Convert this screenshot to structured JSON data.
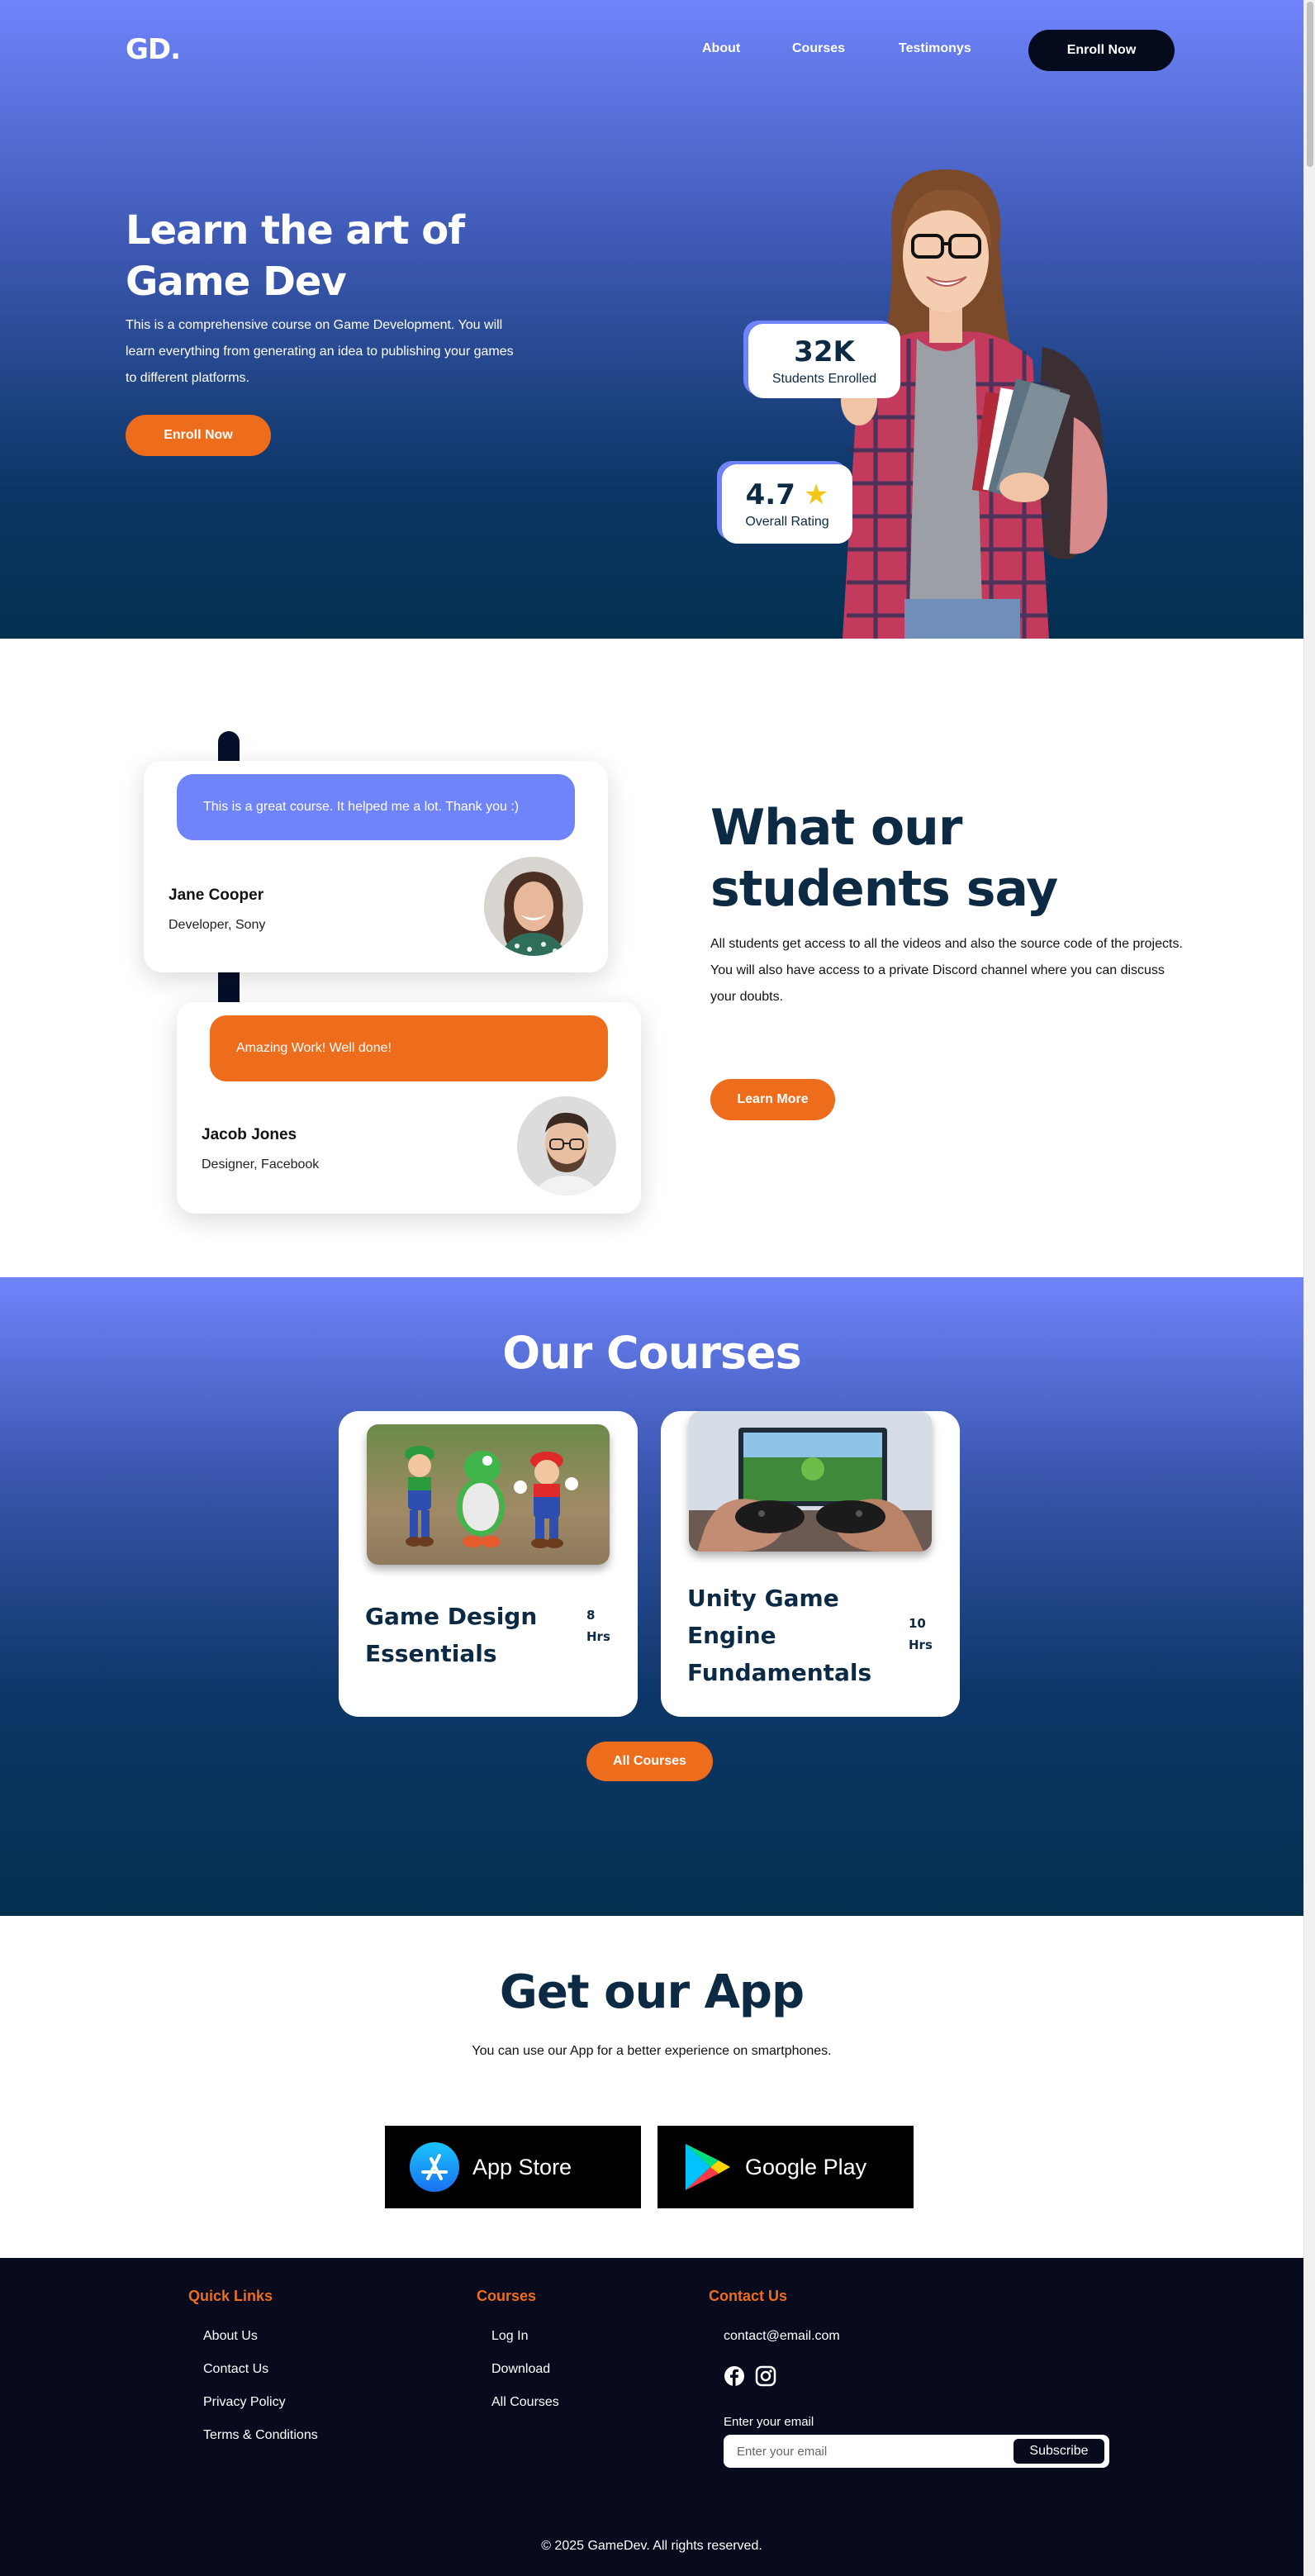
{
  "nav": {
    "logo": "GD.",
    "links": [
      "About",
      "Courses",
      "Testimonys"
    ],
    "cta": "Enroll Now"
  },
  "hero": {
    "title": "Learn the art of Game Dev",
    "description": "This is a comprehensive course on Game Development. You will learn everything from generating an idea to publishing your games to different platforms.",
    "cta": "Enroll Now",
    "stats": [
      {
        "value": "32K",
        "label": "Students Enrolled"
      },
      {
        "value": "4.7",
        "label": "Overall Rating",
        "icon": "star-icon"
      }
    ]
  },
  "testimonials": {
    "items": [
      {
        "quote": "This is a great course. It helped me a lot. Thank you :)",
        "name": "Jane Cooper",
        "role": "Developer, Sony",
        "bubble_color": "#6f84fb"
      },
      {
        "quote": "Amazing Work! Well done!",
        "name": "Jacob Jones",
        "role": "Designer, Facebook",
        "bubble_color": "#ee6d1c"
      }
    ],
    "title": "What our students say",
    "text": "All students get access to all the videos and also the source code of the projects. You will also have access to a private Discord channel where you can discuss your doubts.",
    "cta": "Learn More"
  },
  "courses": {
    "title": "Our Courses",
    "items": [
      {
        "name": "Game Design Essentials",
        "hours_num": "8",
        "hours_unit": "Hrs"
      },
      {
        "name": "Unity Game Engine Fundamentals",
        "hours_num": "10",
        "hours_unit": "Hrs"
      }
    ],
    "cta": "All Courses"
  },
  "app": {
    "title": "Get our App",
    "text": "You can use our App for a better experience on smartphones.",
    "stores": [
      "App Store",
      "Google Play"
    ]
  },
  "footer": {
    "quick_links": {
      "heading": "Quick Links",
      "items": [
        "About Us",
        "Contact Us",
        "Privacy Policy",
        "Terms & Conditions"
      ]
    },
    "courses": {
      "heading": "Courses",
      "items": [
        "Log In",
        "Download",
        "All Courses"
      ]
    },
    "contact": {
      "heading": "Contact Us",
      "email": "contact@email.com",
      "socials": [
        "facebook-icon",
        "instagram-icon"
      ]
    },
    "newsletter": {
      "label": "Enter your email",
      "placeholder": "Enter your email",
      "button": "Subscribe"
    },
    "copyright": "© 2025 GameDev. All rights reserved."
  },
  "colors": {
    "accent": "#ee6d1c",
    "primary": "#6f84fb",
    "dark": "#0c2a44",
    "navy": "#070b1d"
  }
}
